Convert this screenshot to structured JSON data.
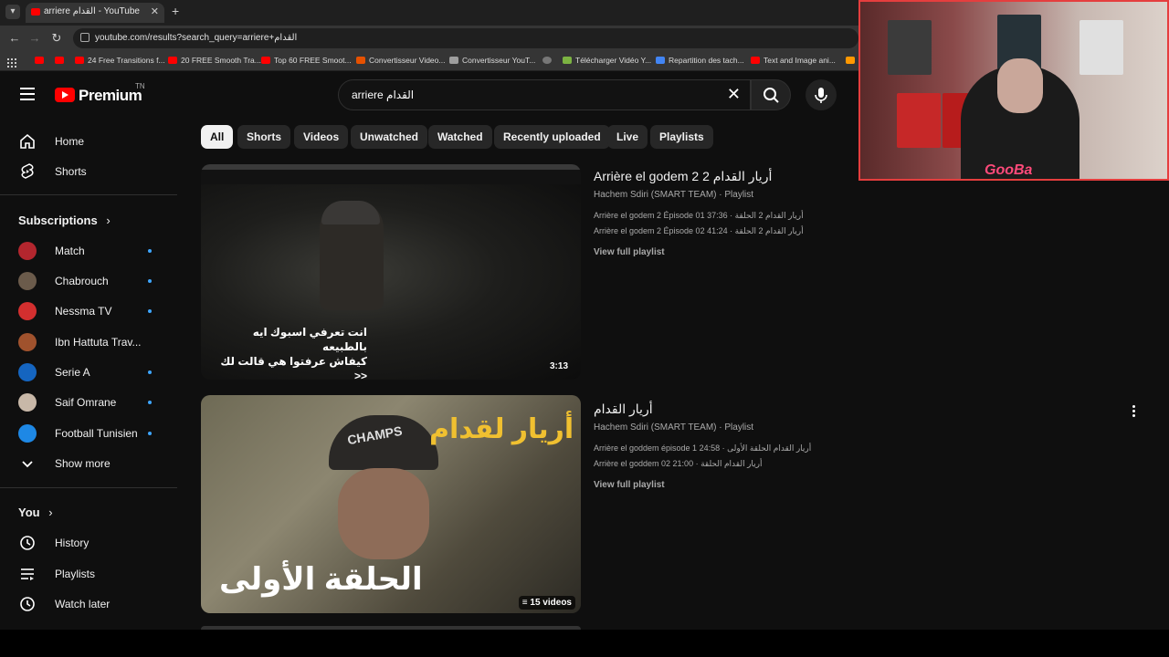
{
  "browser": {
    "tab_title": "arriere القدام - YouTube",
    "url": "youtube.com/results?search_query=arriere+القدام",
    "bookmarks": [
      "24 Free Transitions f...",
      "20 FREE Smooth Tra...",
      "Top 60 FREE Smoot...",
      "Convertisseur Video...",
      "Convertisseur YouT...",
      "Télécharger Vidéo Y...",
      "Repartition des tach...",
      "Text and Image ani..."
    ]
  },
  "webcam": {
    "name": "GooBa"
  },
  "masthead": {
    "logo_text": "Premium",
    "country_code": "TN",
    "search_value": "arriere القدام"
  },
  "sidebar": {
    "main": [
      {
        "label": "Home"
      },
      {
        "label": "Shorts"
      }
    ],
    "subscriptions_title": "Subscriptions",
    "subscriptions": [
      {
        "label": "Match",
        "color": "#b3262e"
      },
      {
        "label": "Chabrouch",
        "color": "#6b5b4b"
      },
      {
        "label": "Nessma TV",
        "color": "#d32f2f"
      },
      {
        "label": "Ibn Hattuta Trav...",
        "color": "#a0522d"
      },
      {
        "label": "Serie A",
        "color": "#1565c0"
      },
      {
        "label": "Saif Omrane",
        "color": "#c8b8a8"
      },
      {
        "label": "Football Tunisien",
        "color": "#1e88e5"
      }
    ],
    "show_more": "Show more",
    "you_title": "You",
    "you_items": [
      {
        "label": "History"
      },
      {
        "label": "Playlists"
      },
      {
        "label": "Watch later"
      }
    ]
  },
  "chips": [
    "All",
    "Shorts",
    "Videos",
    "Unwatched",
    "Watched",
    "Recently uploaded",
    "Live",
    "Playlists"
  ],
  "results": [
    {
      "title": "Arrière el godem 2 أريار القدام 2",
      "meta": "Hachem Sdiri (SMART TEAM) · Playlist",
      "items": [
        "Arrière el godem 2 Épisode 01 أريار القدام 2 الحلقة · 37:36",
        "Arrière el godem 2 Épisode 02 أريار القدام 2 الحلقة · 41:24"
      ],
      "link": "View full playlist",
      "badge": "3:13",
      "subtitle_line1": "انت تعرفي اسبوك ايه بالطبيعه",
      "subtitle_line2": "كيفاش عرفتوا هي قالت لك <<"
    },
    {
      "title": "أريار القدام",
      "meta": "Hachem Sdiri (SMART TEAM) · Playlist",
      "items": [
        "Arrière el goddem épisode 1 أريار القدام الحلقة الأولى · 24:58",
        "Arrière el goddem 02 أريار القدام الحلقة · 21:00"
      ],
      "link": "View full playlist",
      "badge": "15 videos",
      "thumb_title": "أريار لقدام",
      "thumb_caption": "الحلقة الأولى",
      "cap_text": "CHAMPS"
    }
  ]
}
